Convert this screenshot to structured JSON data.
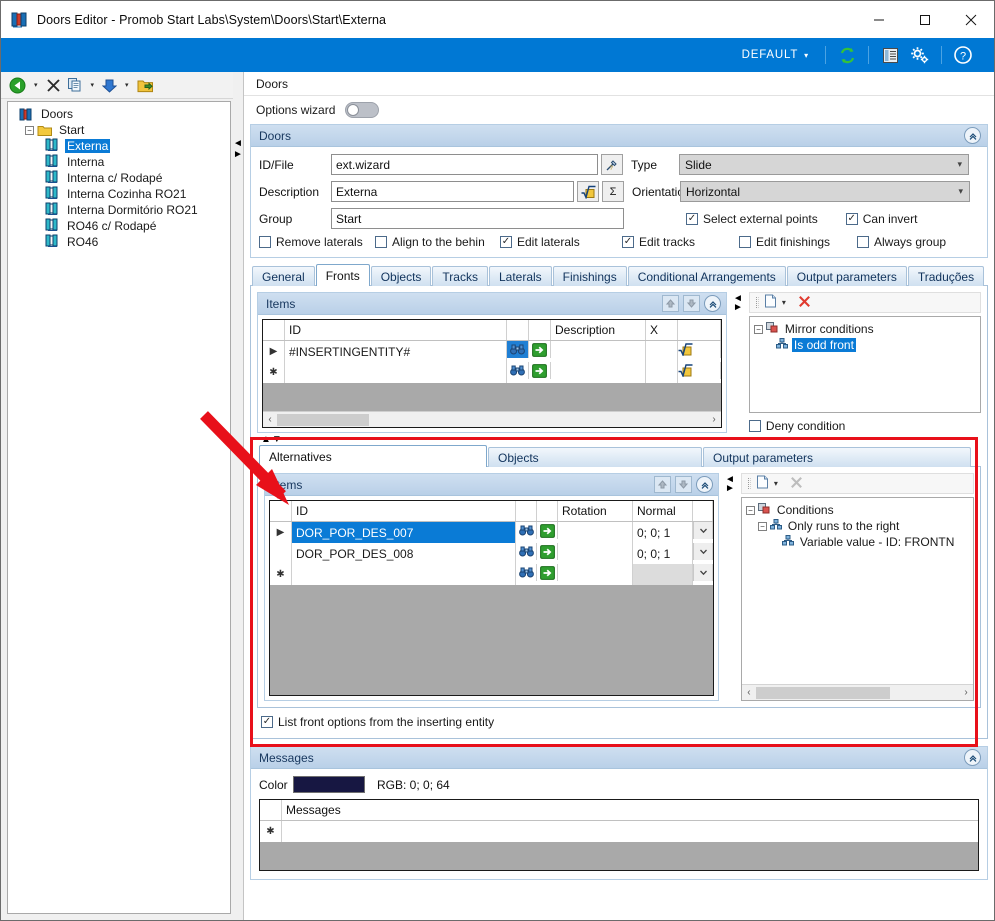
{
  "window": {
    "title": "Doors Editor - Promob Start Labs\\System\\Doors\\Start\\Externa",
    "minimize": "—",
    "maximize": "☐",
    "close": "✕"
  },
  "ribbon": {
    "profile": "DEFAULT",
    "caret": "▾",
    "refresh_icon": "refresh-icon",
    "list_icon": "list-icon",
    "settings_icon": "settings-icon",
    "help_icon": "help-icon"
  },
  "left_toolbar": {
    "back_icon": "back-icon",
    "delete_icon": "delete-icon",
    "copy_icon": "copy-icon",
    "insert_icon": "insert-down-icon",
    "folder_icon": "open-folder-icon",
    "caret": "▾"
  },
  "tree": {
    "root": "Doors",
    "group": "Start",
    "items": [
      {
        "label": "Externa",
        "selected": true
      },
      {
        "label": "Interna",
        "selected": false
      },
      {
        "label": "Interna c/ Rodapé",
        "selected": false
      },
      {
        "label": "Interna Cozinha RO21",
        "selected": false
      },
      {
        "label": "Interna Dormitório RO21",
        "selected": false
      },
      {
        "label": "RO46 c/ Rodapé",
        "selected": false
      },
      {
        "label": "RO46",
        "selected": false
      }
    ],
    "expander_collapse": "−"
  },
  "breadcrumb": "Doors",
  "options_wizard": {
    "label": "Options wizard",
    "on": false
  },
  "doors_group": {
    "title": "Doors",
    "collapse_icon": "«",
    "idfile_label": "ID/File",
    "idfile_value": "ext.wizard",
    "idfile_button_icon": "wizard-pick-icon",
    "description_label": "Description",
    "description_value": "Externa",
    "description_btn1_icon": "formula-icon",
    "description_btn2_icon": "sigma-icon",
    "group_label": "Group",
    "group_value": "Start",
    "type_label": "Type",
    "type_value": "Slide",
    "orientation_label": "Orientation",
    "orientation_value": "Horizontal",
    "checks_right": [
      {
        "label": "Select external points",
        "checked": true
      },
      {
        "label": "Can invert",
        "checked": true
      }
    ],
    "checks_bottom": [
      {
        "label": "Remove laterals",
        "checked": false
      },
      {
        "label": "Align to the behin",
        "checked": false
      },
      {
        "label": "Edit laterals",
        "checked": true
      },
      {
        "label": "Edit tracks",
        "checked": true
      },
      {
        "label": "Edit finishings",
        "checked": false
      },
      {
        "label": "Always group",
        "checked": false
      }
    ]
  },
  "main_tabs": [
    {
      "label": "General",
      "active": false
    },
    {
      "label": "Fronts",
      "active": true
    },
    {
      "label": "Objects",
      "active": false
    },
    {
      "label": "Tracks",
      "active": false
    },
    {
      "label": "Laterals",
      "active": false
    },
    {
      "label": "Finishings",
      "active": false
    },
    {
      "label": "Conditional Arrangements",
      "active": false
    },
    {
      "label": "Output parameters",
      "active": false
    },
    {
      "label": "Traduções",
      "active": false
    }
  ],
  "fronts_items": {
    "title": "Items",
    "up_icon": "▲",
    "down_icon": "▼",
    "collapse_icon": "«",
    "columns": [
      "",
      "ID",
      "",
      "",
      "Description",
      "X",
      ""
    ],
    "rows": [
      {
        "marker": "▶",
        "id": "#INSERTINGENTITY#",
        "search_icon": "binoculars-icon",
        "go_icon": "go-arrow-icon",
        "description": "",
        "x": "",
        "formula_icon": "formula-icon",
        "selected": false
      },
      {
        "marker": "✱",
        "id": "",
        "search_icon": "binoculars-icon",
        "go_icon": "go-arrow-icon",
        "description": "",
        "x": "",
        "formula_icon": "formula-icon",
        "selected": false
      }
    ],
    "hscroll_left": "‹",
    "hscroll_right": "›"
  },
  "mirror_conditions": {
    "new_icon": "new-document-icon",
    "new_caret": "▾",
    "delete_icon": "✕",
    "root": "Mirror conditions",
    "child": "Is odd front",
    "child_selected": true,
    "expander": "−",
    "deny_label": "Deny condition",
    "deny_checked": false
  },
  "sub_tabs": [
    {
      "label": "Alternatives",
      "active": true
    },
    {
      "label": "Objects",
      "active": false
    },
    {
      "label": "Output parameters",
      "active": false
    }
  ],
  "alternatives_items": {
    "title": "Items",
    "up_icon": "▲",
    "down_icon": "▼",
    "collapse_icon": "«",
    "columns": [
      "",
      "ID",
      "",
      "",
      "Rotation",
      "Normal",
      ""
    ],
    "rows": [
      {
        "marker": "▶",
        "id": "DOR_POR_DES_007",
        "search_icon": "binoculars-icon",
        "go_icon": "go-arrow-icon",
        "rotation": "",
        "normal": "0; 0; 1",
        "selected": true
      },
      {
        "marker": "",
        "id": "DOR_POR_DES_008",
        "search_icon": "binoculars-icon",
        "go_icon": "go-arrow-icon",
        "rotation": "",
        "normal": "0; 0; 1",
        "selected": false
      },
      {
        "marker": "✱",
        "id": "",
        "search_icon": "binoculars-icon",
        "go_icon": "go-arrow-icon",
        "rotation": "",
        "normal": "",
        "selected": false
      }
    ]
  },
  "conditions": {
    "new_icon": "new-document-icon",
    "new_caret": "▾",
    "delete_icon": "✕",
    "root": "Conditions",
    "level1": "Only runs to the right",
    "level2": "Variable value - ID: FRONTN",
    "expander": "−",
    "hscroll_left": "‹",
    "hscroll_right": "›"
  },
  "list_front_option": {
    "label": "List front options from the inserting entity",
    "checked": true
  },
  "messages_group": {
    "title": "Messages",
    "collapse_icon": "«",
    "color_label": "Color",
    "color_hex": "#171742",
    "rgb_text": "RGB: 0; 0; 64",
    "column": "Messages",
    "row_marker": "✱"
  },
  "colors": {
    "accent": "#0078d4",
    "selection": "#0a7bd6",
    "panel_header": "#b9d0e8",
    "highlight_box": "#e8101a",
    "grid_fill": "#a9a9a9"
  }
}
